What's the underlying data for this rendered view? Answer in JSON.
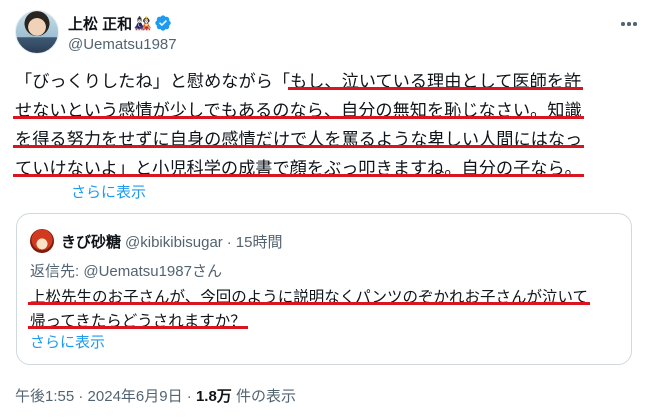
{
  "author": {
    "display_name": "上松 正和",
    "emoji": "🎎",
    "handle": "@Uematsu1987"
  },
  "tweet": {
    "lines": [
      {
        "plain": "「びっくりしたね」と慰めながら「",
        "marked": "もし、泣いている理由として医師を許"
      },
      {
        "plain": "",
        "marked": "せないという感情が少しでもあるのなら、自分の無知を恥じなさい。知識"
      },
      {
        "plain": "",
        "marked": "を得る努力をせずに自身の感情だけで人を罵るような卑しい人間にはなっ"
      },
      {
        "plain": "",
        "marked": "ていけないよ」と小児科学の成書で顔をぶっ叩きますね。自分の子なら。"
      }
    ],
    "show_more": "さらに表示"
  },
  "quote": {
    "display_name": "きび砂糖",
    "handle": "@kibikibisugar",
    "separator": "·",
    "time_ago": "15時間",
    "reply_prefix": "返信先: ",
    "reply_to": "@Uematsu1987さん",
    "lines": [
      "上松先生のお子さんが、今回のように説明なくパンツのぞかれお子さんが泣いて",
      "帰ってきたらどうされますか？"
    ],
    "show_more": "さらに表示"
  },
  "footer": {
    "time": "午後1:55",
    "separator1": "·",
    "date": "2024年6月9日",
    "separator2": "·",
    "views": "1.8万",
    "views_label": "件の表示"
  },
  "colors": {
    "link": "#1d9bf0",
    "muted": "#536471",
    "underline": "#d9161f",
    "verified": "#1d9bf0"
  },
  "icons": {
    "verified": "verified-badge-icon",
    "more": "more-options-icon"
  }
}
